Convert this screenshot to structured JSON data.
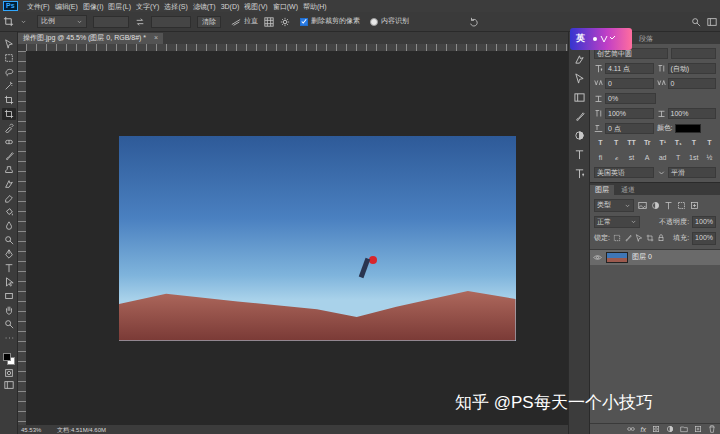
{
  "menubar": {
    "logo": "Ps",
    "items": [
      "文件(F)",
      "编辑(E)",
      "图像(I)",
      "图层(L)",
      "文字(Y)",
      "选择(S)",
      "滤镜(T)",
      "3D(D)",
      "视图(V)",
      "窗口(W)",
      "帮助(H)"
    ]
  },
  "options_bar": {
    "ratio": "比例",
    "clear": "清除",
    "straighten": "拉直",
    "delete_cropped": {
      "label": "删除裁剪的像素",
      "checked": true
    },
    "content_aware": {
      "label": "内容识别",
      "checked": false
    }
  },
  "toolbar": {
    "tools": [
      {
        "selected": false
      },
      {
        "selected": false
      },
      {
        "selected": false
      },
      {
        "selected": false
      },
      {
        "selected": false
      },
      {
        "selected": true
      },
      {
        "selected": false
      },
      {
        "selected": false
      },
      {
        "selected": false
      },
      {
        "selected": false
      },
      {
        "selected": false
      },
      {
        "selected": false
      },
      {
        "selected": false
      },
      {
        "selected": false
      },
      {
        "selected": false
      },
      {
        "selected": false
      },
      {
        "selected": false
      },
      {
        "selected": false
      },
      {
        "selected": false
      },
      {
        "selected": false
      },
      {
        "selected": false
      },
      {
        "selected": false
      }
    ]
  },
  "document": {
    "tab": {
      "title": "操作图.jpg @ 45.5% (图层 0, RGB/8#) *",
      "close": "×"
    }
  },
  "watermark": "知乎 @PS每天一个小技巧",
  "status_bar": {
    "zoom": "45.53%",
    "doc": "文档:4.51M/4.60M"
  },
  "ime": {
    "label": "英"
  },
  "character_panel": {
    "tabs": [
      {
        "label": "段落",
        "selected": false
      }
    ],
    "font_family": "创艺简中圆",
    "size": "4.11 点",
    "leading": "(自动)",
    "kerning": "0",
    "tracking": "0",
    "tsume": "0%",
    "vertical_scale": "100%",
    "horizontal_scale": "100%",
    "baseline_shift": "0 点",
    "color_label": "颜色:",
    "color_swatch": "#000000",
    "style_buttons": [
      "T",
      "T",
      "TT",
      "Tr",
      "T¹",
      "T₁",
      "T",
      "T"
    ],
    "opentype_buttons": [
      "fi",
      "ℴ",
      "st",
      "A",
      "ad",
      "T",
      "1st",
      "½"
    ],
    "language": "美国英语",
    "antialias": "平滑"
  },
  "layers_panel": {
    "tabs": [
      {
        "label": "图层",
        "selected": true
      },
      {
        "label": "通道",
        "selected": false
      }
    ],
    "filter": "类型",
    "blend_mode": "正常",
    "opacity_label": "不透明度:",
    "opacity": "100%",
    "lock_label": "锁定:",
    "fill_label": "填充:",
    "fill": "100%",
    "layers": [
      {
        "name": "图层 0",
        "visible": true,
        "selected": true
      }
    ],
    "footer_fx": "fx"
  }
}
